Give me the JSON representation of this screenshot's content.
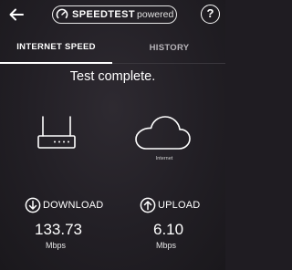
{
  "header": {
    "back_icon": "arrow-left-icon",
    "brand_name": "SPEEDTEST",
    "brand_suffix": "powered",
    "brand_icon": "speed-gauge-icon",
    "help_label": "?"
  },
  "tabs": [
    {
      "label": "INTERNET SPEED",
      "active": true
    },
    {
      "label": "HISTORY",
      "active": false
    }
  ],
  "status": "Test complete.",
  "diagram": {
    "device_icon": "router-icon",
    "internet_icon": "cloud-icon",
    "internet_label": "Internet"
  },
  "download": {
    "icon": "arrow-down-circle-icon",
    "label": "DOWNLOAD",
    "value": "133.73",
    "unit": "Mbps"
  },
  "upload": {
    "icon": "arrow-up-circle-icon",
    "label": "UPLOAD",
    "value": "6.10",
    "unit": "Mbps"
  },
  "colors": {
    "background": "#1f1c22",
    "text": "#ffffff",
    "inactive_tab": "#b8b5ba"
  }
}
